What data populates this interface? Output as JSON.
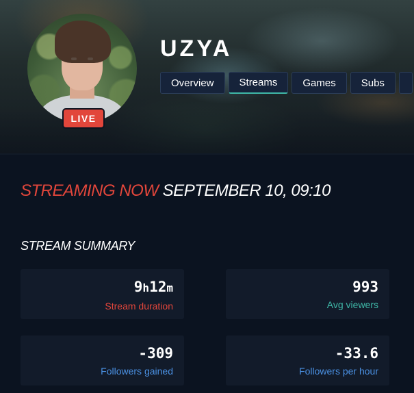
{
  "channel": {
    "name": "UZYA",
    "live_badge": "LIVE"
  },
  "tabs": [
    {
      "label": "Overview",
      "active": false
    },
    {
      "label": "Streams",
      "active": true
    },
    {
      "label": "Games",
      "active": false
    },
    {
      "label": "Subs",
      "active": false
    }
  ],
  "stream": {
    "status_label": "STREAMING NOW",
    "date_text": "SEPTEMBER 10, 09:10"
  },
  "summary": {
    "title": "STREAM SUMMARY",
    "duration": {
      "hours": "9",
      "h_unit": "h",
      "minutes": "12",
      "m_unit": "m",
      "label": "Stream duration"
    },
    "avg_viewers": {
      "value": "993",
      "label": "Avg viewers"
    },
    "followers_gained": {
      "value": "-309",
      "label": "Followers gained"
    },
    "followers_per_hour": {
      "value": "-33.6",
      "label": "Followers per hour"
    }
  },
  "colors": {
    "live_red": "#e2463b",
    "teal": "#3fb8a8",
    "blue": "#4a90e2",
    "background": "#0b1320"
  }
}
